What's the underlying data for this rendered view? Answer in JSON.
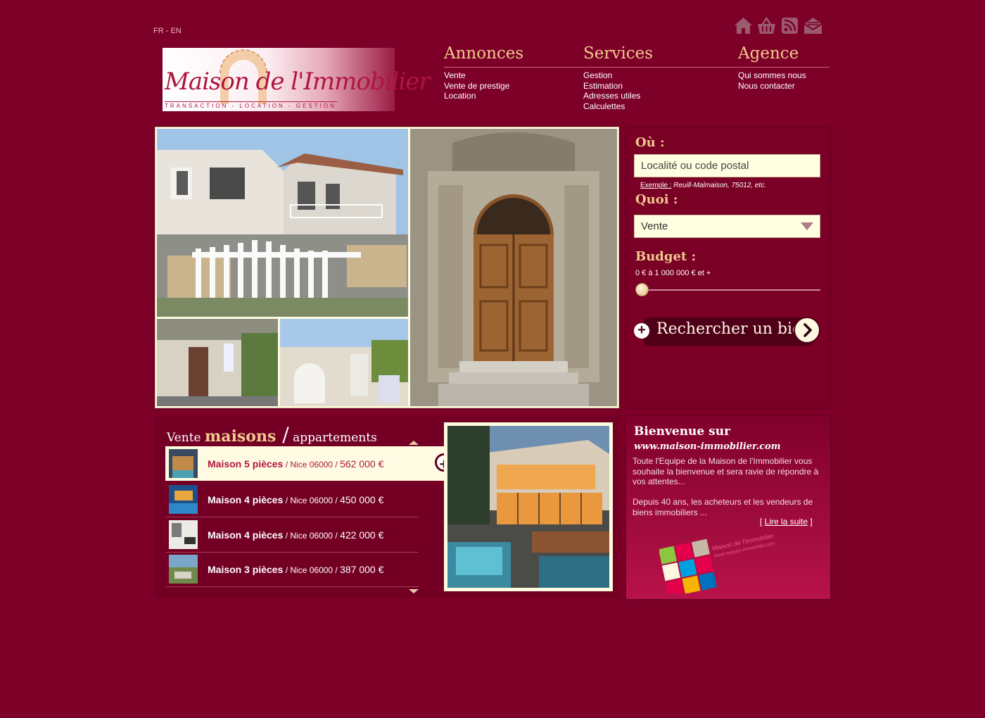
{
  "lang": {
    "fr": "FR",
    "sep": " - ",
    "en": "EN"
  },
  "top_icons": [
    "home-icon",
    "basket-icon",
    "rss-icon",
    "mail-icon"
  ],
  "logo": {
    "name": "Maison de l'Immobilier",
    "tagline": "TRANSACTION - LOCATION - GESTION"
  },
  "nav": {
    "annonces": {
      "title": "Annonces",
      "items": [
        "Vente",
        "Vente de prestige",
        "Location"
      ]
    },
    "services": {
      "title": "Services",
      "items": [
        "Gestion",
        "Estimation",
        "Adresses utiles",
        "Calculettes"
      ]
    },
    "agence": {
      "title": "Agence",
      "items": [
        "Qui sommes nous",
        "Nous contacter"
      ]
    }
  },
  "search": {
    "where_label": "Où :",
    "where_placeholder": "Localité ou code postal",
    "example_label": "Exemple :",
    "example_text": " Reuill-Malmaison, 75012, etc.",
    "what_label": "Quoi :",
    "what_value": "Vente",
    "budget_label": "Budget :",
    "budget_range": "0 € à 1 000 000 € et +",
    "budget_level": 0,
    "button_label": "Rechercher un bien"
  },
  "listings": {
    "title_pre": "Vente ",
    "title_hl": "maisons",
    "title_sep": " /",
    "title_post": " appartements",
    "rows": [
      {
        "name": "Maison 5 pièces",
        "loc": " / Nice 06000 / ",
        "price": "562 000 €"
      },
      {
        "name": "Maison 4 pièces",
        "loc": " / Nice 06000 / ",
        "price": "450 000 €"
      },
      {
        "name": "Maison 4 pièces",
        "loc": " / Nice 06000 / ",
        "price": "422 000 €"
      },
      {
        "name": "Maison 3 pièces",
        "loc": " / Nice 06000 / ",
        "price": "387 000 €"
      }
    ]
  },
  "welcome": {
    "title": "Bienvenue sur",
    "url": "www.maison-immobilier.com",
    "p1": "Toute l'Equipe de la Maison de l'Immobilier vous souhaite la bienvenue et sera ravie de répondre à vos attentes...",
    "p2": "Depuis 40 ans, les acheteurs et les vendeurs de biens immobiliers ...",
    "more_open": "[ ",
    "more_label": "Lire la suite",
    "more_close": " ]",
    "logo_text": "Maison de l'Immobilier",
    "logo_url": "www.maison-immobilier.com"
  },
  "colors": {
    "background": "#7d0029",
    "accent": "#f1c98d",
    "brand": "#b0153e",
    "panel_light": "#fffbe0"
  }
}
